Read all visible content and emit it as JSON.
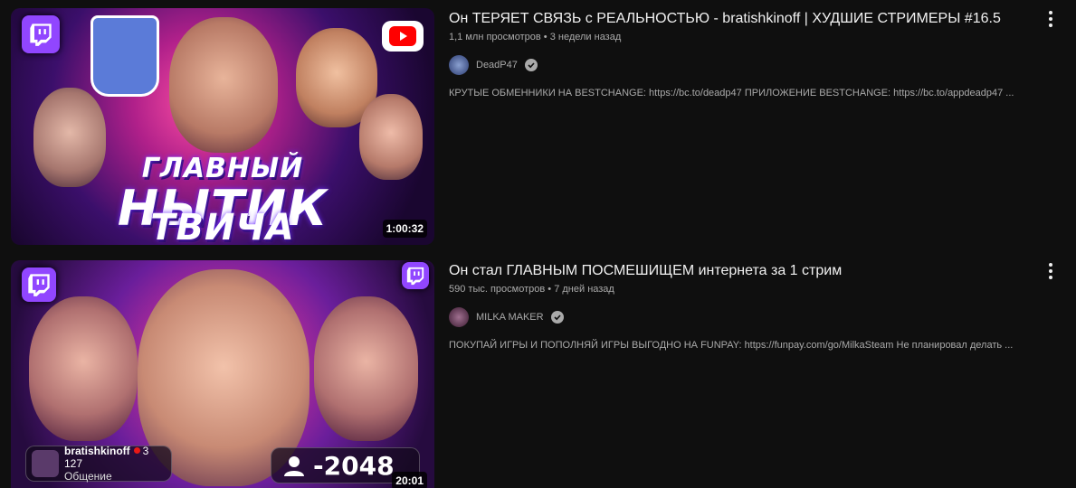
{
  "results": [
    {
      "title": "Он ТЕРЯЕТ СВЯЗЬ с РЕАЛЬНОСТЬЮ - bratishkinoff | ХУДШИЕ СТРИМЕРЫ #16.5",
      "views": "1,1 млн просмотров",
      "age": "3 недели назад",
      "channel": "DeadP47",
      "description": "КРУТЫЕ ОБМЕННИКИ НА BESTCHANGE: https://bc.to/deadp47 ПРИЛОЖЕНИЕ BESTCHANGE: https://bc.to/appdeadp47 ...",
      "duration": "1:00:32",
      "thumb_text": [
        "ГЛАВНЫЙ",
        "НЫТИК",
        "ТВИЧА"
      ]
    },
    {
      "title": "Он стал ГЛАВНЫМ ПОСМЕШИЩЕМ интернета за 1 стрим",
      "views": "590 тыс. просмотров",
      "age": "7 дней назад",
      "channel": "MILKA MAKER",
      "description": "ПОКУПАЙ ИГРЫ И ПОПОЛНЯЙ ИГРЫ ВЫГОДНО НА FUNPAY: https://funpay.com/go/MilkaSteam Не планировал делать ...",
      "duration": "20:01",
      "overlay_stream_name": "bratishkinoff",
      "overlay_viewers": "3 127",
      "overlay_category": "Общение",
      "overlay_counter": "-2048"
    }
  ],
  "separator": "•",
  "colors": {
    "background": "#0f0f0f",
    "title": "#f1f1f1",
    "meta": "#aaaaaa",
    "twitch": "#9146ff",
    "youtube_red": "#ff0000"
  }
}
